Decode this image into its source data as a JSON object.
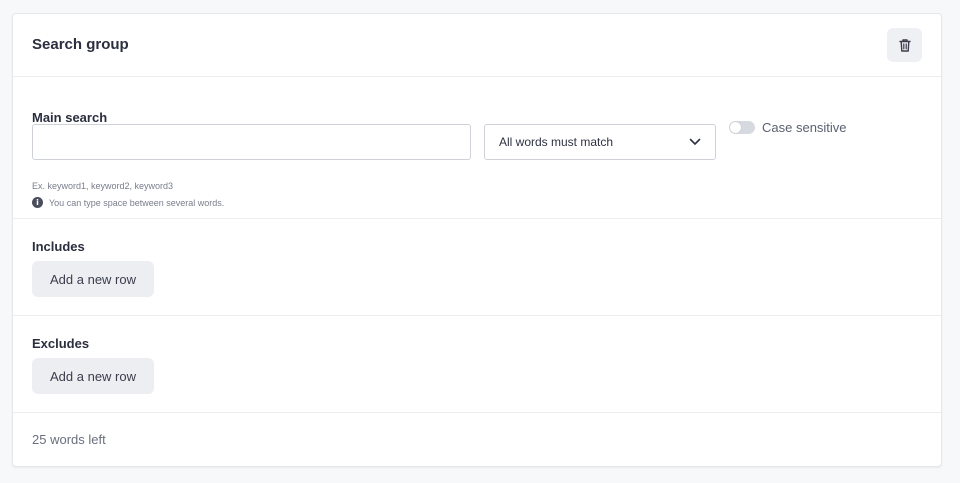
{
  "card": {
    "title": "Search group",
    "delete_icon": "trash-icon"
  },
  "main_search": {
    "label": "Main search",
    "input_value": "",
    "input_placeholder": "",
    "match_select": {
      "selected": "All words must match",
      "icon": "chevron-down-icon"
    },
    "case_sensitive": {
      "label": "Case sensitive",
      "checked": false
    },
    "hint_example": "Ex. keyword1, keyword2, keyword3",
    "hint_info": "You can type space between several words.",
    "info_icon": "info-icon"
  },
  "includes": {
    "label": "Includes",
    "add_button": "Add a new row"
  },
  "excludes": {
    "label": "Excludes",
    "add_button": "Add a new row"
  },
  "footer": {
    "words_left": "25 words left"
  }
}
